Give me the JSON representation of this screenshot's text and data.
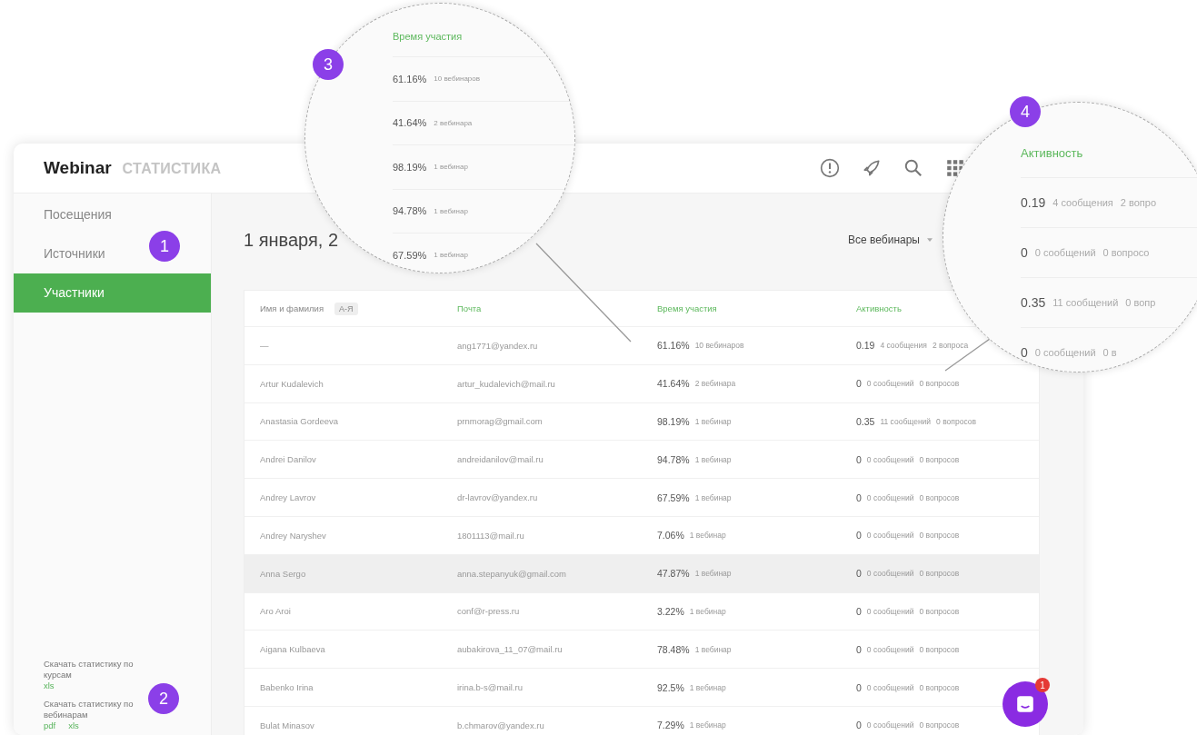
{
  "app": {
    "logo": "Webinar",
    "section": "СТАТИСТИКА"
  },
  "sidebar": {
    "items": [
      {
        "label": "Посещения",
        "selected": false
      },
      {
        "label": "Источники",
        "selected": false
      },
      {
        "label": "Участники",
        "selected": true
      }
    ],
    "downloads": [
      {
        "title": "Скачать статистику по курсам",
        "links": [
          "xls"
        ]
      },
      {
        "title": "Скачать статистику по вебинарам",
        "links": [
          "pdf",
          "xls"
        ]
      }
    ]
  },
  "content": {
    "date": "1 января, 2",
    "filter": "Все вебинары"
  },
  "table": {
    "columns": [
      {
        "label": "Имя и фамилия",
        "sort": "А-Я",
        "highlighted": false
      },
      {
        "label": "Почта",
        "highlighted": true
      },
      {
        "label": "Время участия",
        "highlighted": true
      },
      {
        "label": "Активность",
        "highlighted": true
      }
    ],
    "rows": [
      {
        "name": "—",
        "email": "ang1771@yandex.ru",
        "time": "61.16%",
        "webinars": "10 вебинаров",
        "score": "0.19",
        "messages": "4 сообщения",
        "questions": "2 вопроса",
        "hovered": false
      },
      {
        "name": "Artur Kudalevich",
        "email": "artur_kudalevich@mail.ru",
        "time": "41.64%",
        "webinars": "2 вебинара",
        "score": "0",
        "messages": "0 сообщений",
        "questions": "0 вопросов",
        "hovered": false
      },
      {
        "name": "Anastasia Gordeeva",
        "email": "prnmorag@gmail.com",
        "time": "98.19%",
        "webinars": "1 вебинар",
        "score": "0.35",
        "messages": "11 сообщений",
        "questions": "0 вопросов",
        "hovered": false
      },
      {
        "name": "Andrei Danilov",
        "email": "andreidanilov@mail.ru",
        "time": "94.78%",
        "webinars": "1 вебинар",
        "score": "0",
        "messages": "0 сообщений",
        "questions": "0 вопросов",
        "hovered": false
      },
      {
        "name": "Andrey Lavrov",
        "email": "dr-lavrov@yandex.ru",
        "time": "67.59%",
        "webinars": "1 вебинар",
        "score": "0",
        "messages": "0 сообщений",
        "questions": "0 вопросов",
        "hovered": false
      },
      {
        "name": "Andrey Naryshev",
        "email": "1801113@mail.ru",
        "time": "7.06%",
        "webinars": "1 вебинар",
        "score": "0",
        "messages": "0 сообщений",
        "questions": "0 вопросов",
        "hovered": false
      },
      {
        "name": "Anna Sergo",
        "email": "anna.stepanyuk@gmail.com",
        "time": "47.87%",
        "webinars": "1 вебинар",
        "score": "0",
        "messages": "0 сообщений",
        "questions": "0 вопросов",
        "hovered": true
      },
      {
        "name": "Aro Aroi",
        "email": "conf@r-press.ru",
        "time": "3.22%",
        "webinars": "1 вебинар",
        "score": "0",
        "messages": "0 сообщений",
        "questions": "0 вопросов",
        "hovered": false
      },
      {
        "name": "Aigana Kulbaeva",
        "email": "aubakirova_11_07@mail.ru",
        "time": "78.48%",
        "webinars": "1 вебинар",
        "score": "0",
        "messages": "0 сообщений",
        "questions": "0 вопросов",
        "hovered": false
      },
      {
        "name": "Babenko Irina",
        "email": "irina.b-s@mail.ru",
        "time": "92.5%",
        "webinars": "1 вебинар",
        "score": "0",
        "messages": "0 сообщений",
        "questions": "0 вопросов",
        "hovered": false
      },
      {
        "name": "Bulat Minasov",
        "email": "b.chmarov@yandex.ru",
        "time": "7.29%",
        "webinars": "1 вебинар",
        "score": "0",
        "messages": "0 сообщений",
        "questions": "0 вопросов",
        "hovered": false
      }
    ]
  },
  "magnifiers": [
    {
      "header": "Время участия",
      "rows": [
        {
          "value": "61.16%",
          "notes": [
            "10 вебинаров"
          ]
        },
        {
          "value": "41.64%",
          "notes": [
            "2 вебинара"
          ]
        },
        {
          "value": "98.19%",
          "notes": [
            "1 вебинар"
          ]
        },
        {
          "value": "94.78%",
          "notes": [
            "1 вебинар"
          ]
        },
        {
          "value": "67.59%",
          "notes": [
            "1 вебинар"
          ]
        }
      ]
    },
    {
      "header": "Активность",
      "rows": [
        {
          "value": "0.19",
          "notes": [
            "4 сообщения",
            "2 вопро"
          ]
        },
        {
          "value": "0",
          "notes": [
            "0 сообщений",
            "0 вопросо"
          ]
        },
        {
          "value": "0.35",
          "notes": [
            "11 сообщений",
            "0 вопр"
          ]
        },
        {
          "value": "0",
          "notes": [
            "0 сообщений",
            "0 в"
          ]
        }
      ]
    }
  ],
  "markers": [
    {
      "label": "1"
    },
    {
      "label": "2"
    },
    {
      "label": "3"
    },
    {
      "label": "4"
    }
  ],
  "chat": {
    "badge": "1"
  }
}
